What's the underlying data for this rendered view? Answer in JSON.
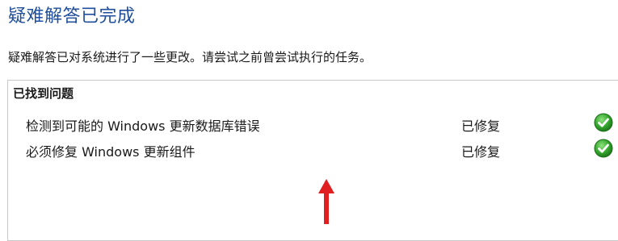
{
  "window": {
    "title": "疑难解答已完成",
    "description": "疑难解答已对系统进行了一些更改。请尝试之前曾尝试执行的任务。"
  },
  "problems_panel": {
    "header": "已找到问题",
    "rows": [
      {
        "name": "检测到可能的 Windows 更新数据库错误",
        "status": "已修复",
        "status_icon": "check-icon",
        "status_color": "#2ea02e"
      },
      {
        "name": "必须修复 Windows 更新组件",
        "status": "已修复",
        "status_icon": "check-icon",
        "status_color": "#2ea02e"
      }
    ]
  },
  "colors": {
    "title": "#1f4e9c",
    "annotation_arrow": "#e02020"
  }
}
